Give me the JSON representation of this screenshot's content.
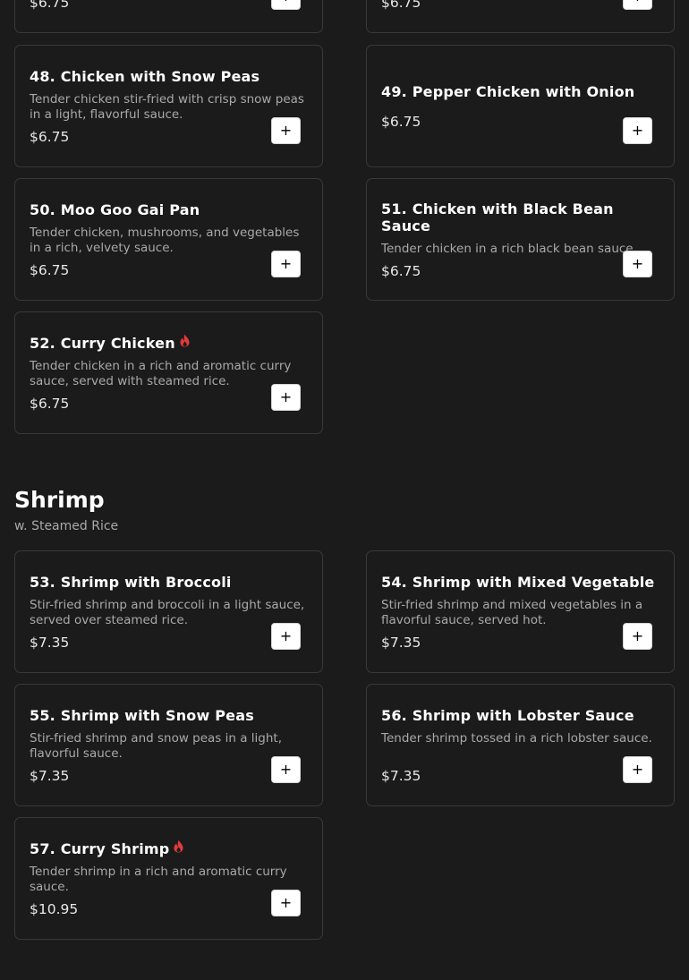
{
  "partial": {
    "left_price": "$6.75",
    "right_price": "$6.75"
  },
  "chicken_items": [
    {
      "name": "48. Chicken with Snow Peas",
      "description": "Tender chicken stir-fried with crisp snow peas in a light, flavorful sauce.",
      "price": "$6.75",
      "spicy": false
    },
    {
      "name": "49. Pepper Chicken with Onion",
      "description": "",
      "price": "$6.75",
      "spicy": false
    },
    {
      "name": "50. Moo Goo Gai Pan",
      "description": "Tender chicken, mushrooms, and vegetables in a rich, velvety sauce.",
      "price": "$6.75",
      "spicy": false
    },
    {
      "name": "51. Chicken with Black Bean Sauce",
      "description": "Tender chicken in a rich black bean sauce.",
      "price": "$6.75",
      "spicy": false
    },
    {
      "name": "52. Curry Chicken",
      "description": "Tender chicken in a rich and aromatic curry sauce, served with steamed rice.",
      "price": "$6.75",
      "spicy": true
    }
  ],
  "shrimp_section": {
    "title": "Shrimp",
    "subtitle": "w. Steamed Rice"
  },
  "shrimp_items": [
    {
      "name": "53. Shrimp with Broccoli",
      "description": "Stir-fried shrimp and broccoli in a light sauce, served over steamed rice.",
      "price": "$7.35",
      "spicy": false
    },
    {
      "name": "54. Shrimp with Mixed Vegetable",
      "description": "Stir-fried shrimp and mixed vegetables in a flavorful sauce, served hot.",
      "price": "$7.35",
      "spicy": false
    },
    {
      "name": "55. Shrimp with Snow Peas",
      "description": "Stir-fried shrimp and snow peas in a light, flavorful sauce.",
      "price": "$7.35",
      "spicy": false
    },
    {
      "name": "56. Shrimp with Lobster Sauce",
      "description": "Tender shrimp tossed in a rich lobster sauce.",
      "price": "$7.35",
      "spicy": false
    },
    {
      "name": "57. Curry Shrimp",
      "description": "Tender shrimp in a rich and aromatic curry sauce.",
      "price": "$10.95",
      "spicy": true
    }
  ],
  "add_button_symbol": "+",
  "icons": {
    "spicy": "flame-icon",
    "add": "plus-icon"
  },
  "colors": {
    "background": "#1c1b1c",
    "card_border": "#3a393a",
    "spicy": "#e23b3b",
    "muted_text": "#a9a9a9"
  }
}
